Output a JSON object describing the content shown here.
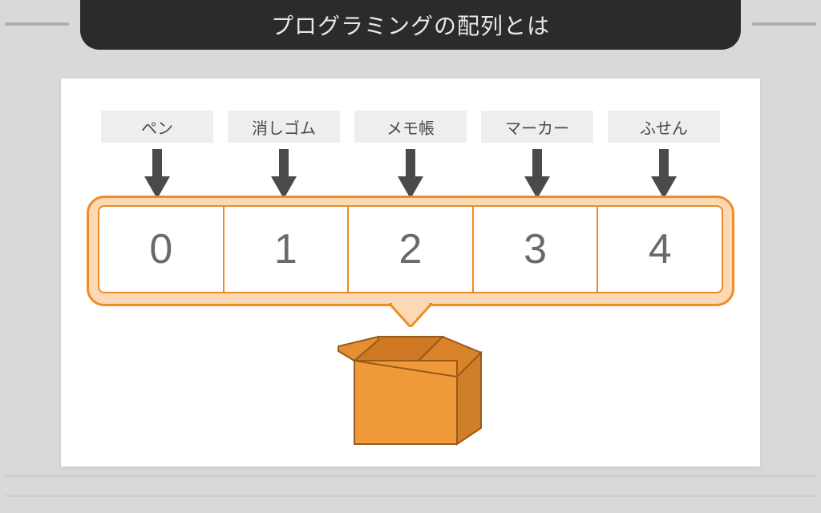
{
  "title": "プログラミングの配列とは",
  "items": [
    "ペン",
    "消しゴム",
    "メモ帳",
    "マーカー",
    "ふせん"
  ],
  "indices": [
    "0",
    "1",
    "2",
    "3",
    "4"
  ],
  "colors": {
    "accent": "#ee8c25",
    "accent_light": "#fbd9b5",
    "arrow": "#4a4a4a",
    "header_bg": "#2b2b2b",
    "page_bg": "#d9d9d9"
  }
}
